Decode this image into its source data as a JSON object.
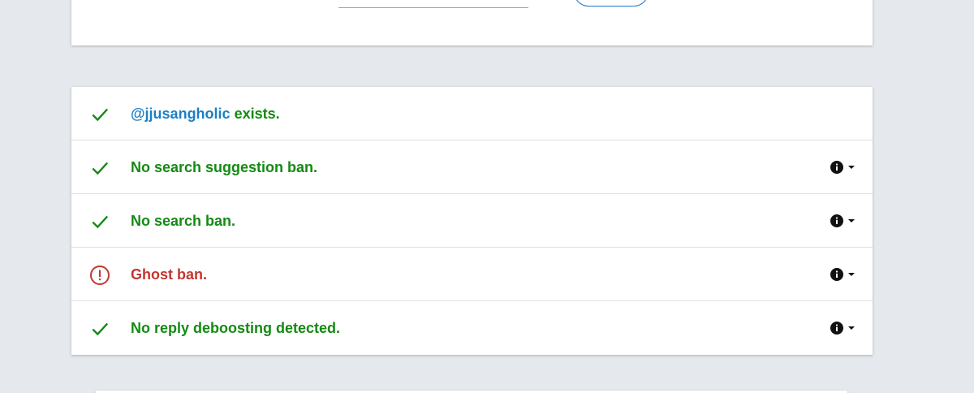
{
  "search": {
    "username_value": "",
    "button_label": ""
  },
  "results": [
    {
      "status": "ok",
      "handle": "@jjusangholic",
      "text": "exists.",
      "has_details": false
    },
    {
      "status": "ok",
      "text": "No search suggestion ban.",
      "has_details": true
    },
    {
      "status": "ok",
      "text": "No search ban.",
      "has_details": true
    },
    {
      "status": "bad",
      "text": "Ghost ban.",
      "has_details": true
    },
    {
      "status": "ok",
      "text": "No reply deboosting detected.",
      "has_details": true
    }
  ],
  "icons": {
    "ok": "check-icon",
    "bad": "alert-circle-icon",
    "details": "info-icon",
    "expand": "caret-down-icon"
  },
  "colors": {
    "ok": "#138a13",
    "bad": "#c6352f",
    "link": "#1d7fc4",
    "background": "#e5e9ed",
    "accent": "#1976d2"
  }
}
